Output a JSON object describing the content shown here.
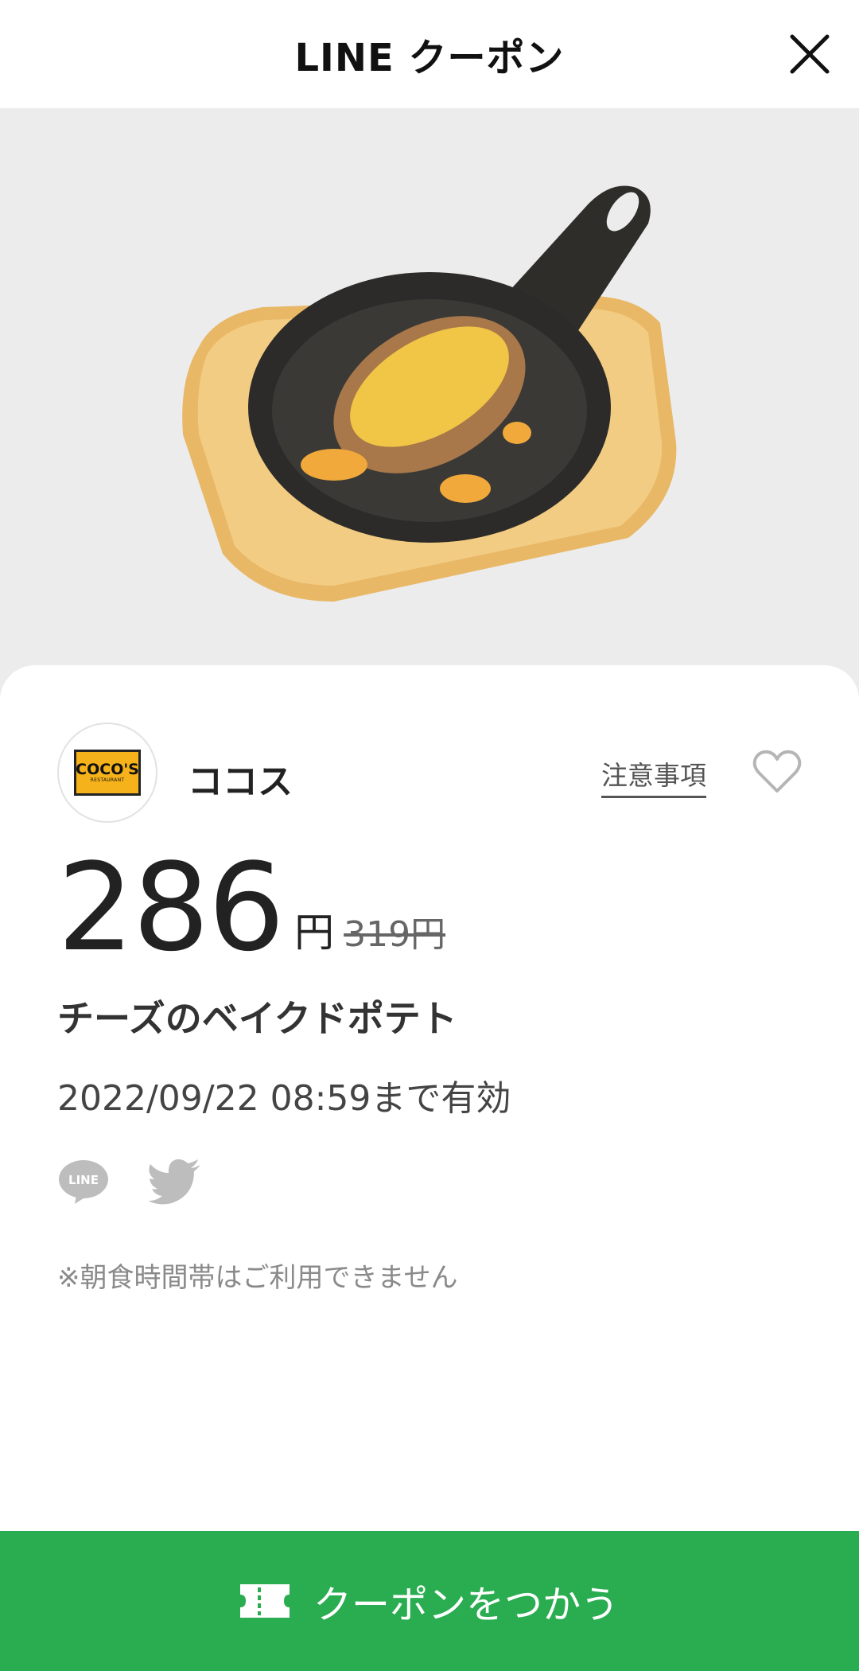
{
  "header": {
    "title": "LINE クーポン"
  },
  "store": {
    "name": "ココス",
    "logo_text": "COCO'S",
    "logo_sub": "RESTAURANT"
  },
  "notes_link": "注意事項",
  "price": {
    "value": "286",
    "unit": "円",
    "original": "319円"
  },
  "product": {
    "name": "チーズのベイクドポテト"
  },
  "validity": "2022/09/22  08:59まで有効",
  "share": {
    "line_label": "LINE"
  },
  "note": "※朝食時間帯はご利用できません",
  "button": {
    "label": "クーポンをつかう"
  },
  "colors": {
    "accent": "#2aac50",
    "background": "#ececec",
    "card": "#ffffff"
  },
  "icons": [
    "close-icon",
    "heart-icon",
    "line-share-icon",
    "twitter-share-icon",
    "ticket-icon"
  ]
}
